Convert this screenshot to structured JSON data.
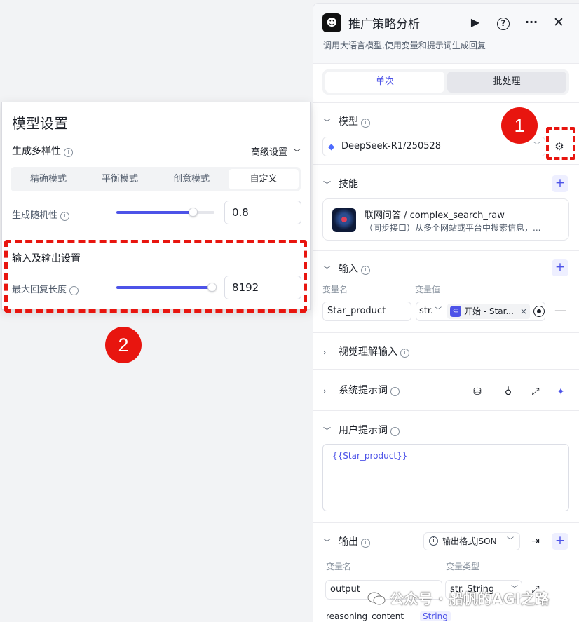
{
  "node": {
    "title": "推广策略分析",
    "subtitle": "调用大语言模型,使用变量和提示词生成回复",
    "icons": [
      "run-icon",
      "help-icon",
      "more-icon",
      "close-icon"
    ]
  },
  "run_mode": {
    "single": "单次",
    "batch": "批处理",
    "selected": "单次"
  },
  "model_section": {
    "label": "模型",
    "value": "DeepSeek-R1/250528"
  },
  "skills_section": {
    "label": "技能",
    "item_name": "联网问答 / complex_search_raw",
    "item_desc": "（同步接口）从多个网站或平台中搜索信息，..."
  },
  "input_section": {
    "label": "输入",
    "col_name": "变量名",
    "col_value": "变量值",
    "row": {
      "name": "Star_product",
      "type": "str.",
      "ref": "开始 - Star..."
    }
  },
  "vision_section": {
    "label": "视觉理解输入"
  },
  "system_prompt_section": {
    "label": "系统提示词"
  },
  "user_prompt_section": {
    "label": "用户提示词",
    "content": "{{Star_product}}"
  },
  "output_section": {
    "label": "输出",
    "format": "输出格式JSON",
    "col_name": "变量名",
    "col_type": "变量类型",
    "row1": {
      "name": "output",
      "type": "str. String"
    },
    "row2": {
      "name": "reasoning_content",
      "type": "String"
    }
  },
  "model_settings": {
    "title": "模型设置",
    "diversity_label": "生成多样性",
    "advanced": "高级设置",
    "modes": [
      "精确模式",
      "平衡模式",
      "创意模式",
      "自定义"
    ],
    "selected_mode": "自定义",
    "temperature_label": "生成随机性",
    "temperature_value": "0.8",
    "temperature_fraction": 0.8,
    "io_title": "输入及输出设置",
    "max_len_label": "最大回复长度",
    "max_len_value": "8192",
    "max_len_fraction": 1.0
  },
  "annotations": {
    "badge1": "1",
    "badge2": "2",
    "color": "#e8150f"
  },
  "watermark": "公众号 · 船帆的AGI之路",
  "colors": {
    "accent": "#4d53e8",
    "annotation_red": "#e8150f"
  }
}
